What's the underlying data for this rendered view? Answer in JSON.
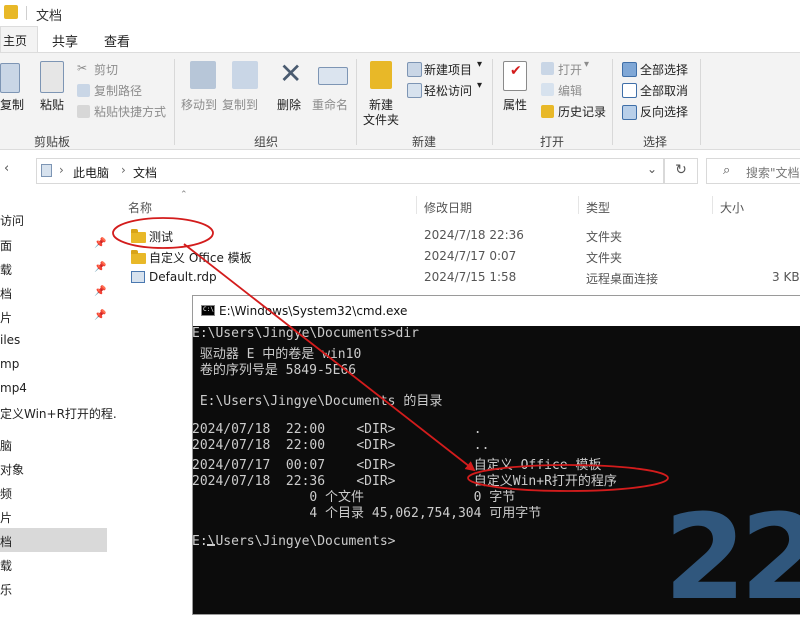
{
  "window": {
    "title": "文档"
  },
  "ribbon_tabs": [
    "主页",
    "共享",
    "查看"
  ],
  "ribbon": {
    "clipboard": {
      "copy": "复制",
      "paste": "粘贴",
      "cut": "剪切",
      "copy_path": "复制路径",
      "paste_shortcut": "粘贴快捷方式",
      "label": "剪贴板"
    },
    "organize": {
      "move_to": "移动到",
      "copy_to": "复制到",
      "delete": "删除",
      "rename": "重命名",
      "label": "组织"
    },
    "new": {
      "new_folder_line1": "新建",
      "new_folder_line2": "文件夹",
      "new_item": "新建项目",
      "easy_access": "轻松访问",
      "label": "新建"
    },
    "open": {
      "properties": "属性",
      "open": "打开",
      "edit": "编辑",
      "history": "历史记录",
      "label": "打开"
    },
    "select": {
      "select_all": "全部选择",
      "select_none": "全部取消",
      "invert": "反向选择",
      "label": "选择"
    }
  },
  "address": {
    "crumbs": [
      "此电脑",
      "文档"
    ],
    "search_placeholder": "搜索\"文档"
  },
  "nav_pane": [
    "访问",
    "面",
    "载",
    "档",
    "片",
    "iles",
    "mp",
    "mp4",
    "定义Win+R打开的程.",
    "脑",
    "对象",
    "频",
    "片",
    "档",
    "载",
    "乐"
  ],
  "columns": {
    "name": "名称",
    "date": "修改日期",
    "type": "类型",
    "size": "大小"
  },
  "files": [
    {
      "name": "测试",
      "date": "2024/7/18 22:36",
      "type": "文件夹",
      "size": ""
    },
    {
      "name": "自定义 Office 模板",
      "date": "2024/7/17 0:07",
      "type": "文件夹",
      "size": ""
    },
    {
      "name": "Default.rdp",
      "date": "2024/7/15 1:58",
      "type": "远程桌面连接",
      "size": "3 KB"
    }
  ],
  "cmd": {
    "title": "E:\\Windows\\System32\\cmd.exe",
    "lines": [
      "E:\\Users\\Jingye\\Documents>dir",
      " 驱动器 E 中的卷是 win10",
      " 卷的序列号是 5849-5E66",
      "",
      " E:\\Users\\Jingye\\Documents 的目录",
      "",
      "2024/07/18  22:00    <DIR>          .",
      "2024/07/18  22:00    <DIR>          ..",
      "2024/07/17  00:07    <DIR>          自定义 Office 模板",
      "2024/07/18  22:36    <DIR>          自定义Win+R打开的程序",
      "               0 个文件              0 字节",
      "               4 个目录 45,062,754,304 可用字节",
      "",
      "E:\\Users\\Jingye\\Documents>"
    ]
  },
  "decoration": {
    "digits": "22"
  },
  "colors": {
    "accent_blue": "#1a64c8",
    "annotation_red": "#d31c1c",
    "folder_yellow": "#e8b828",
    "console_bg": "#0c0c0c"
  }
}
